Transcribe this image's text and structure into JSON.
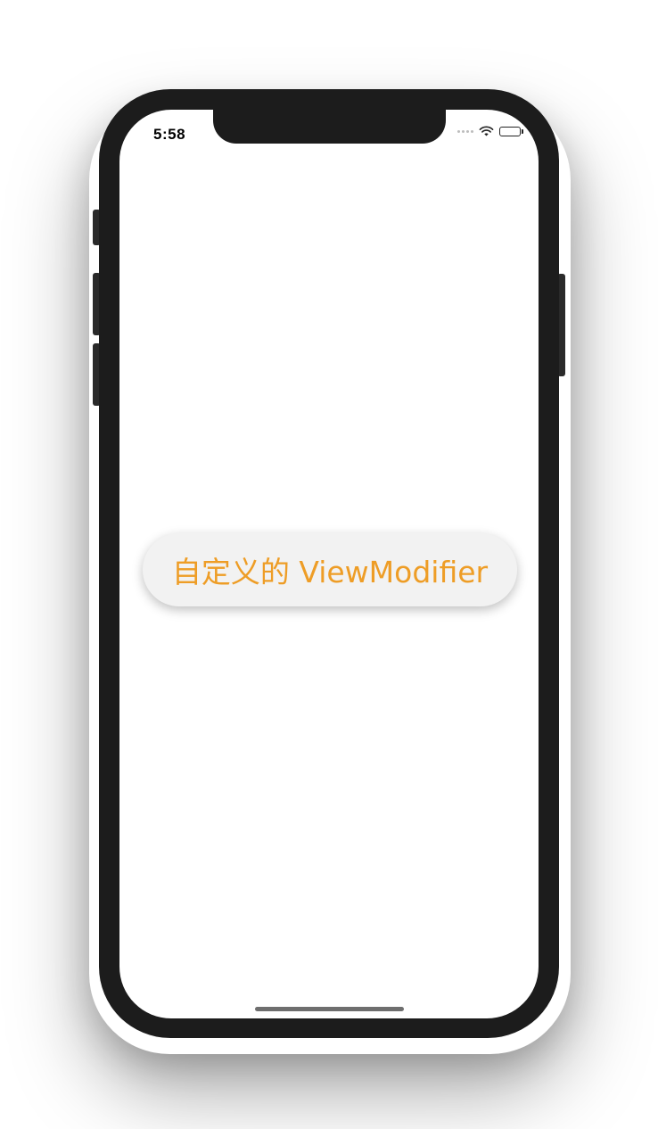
{
  "status_bar": {
    "time": "5:58",
    "wifi_icon": "wifi-icon",
    "battery_icon": "battery-icon"
  },
  "content": {
    "modifier_label": "自定义的 ViewModifier"
  },
  "colors": {
    "accent": "#EE9D26",
    "pill_background": "#F2F2F2",
    "frame": "#1C1C1C"
  }
}
